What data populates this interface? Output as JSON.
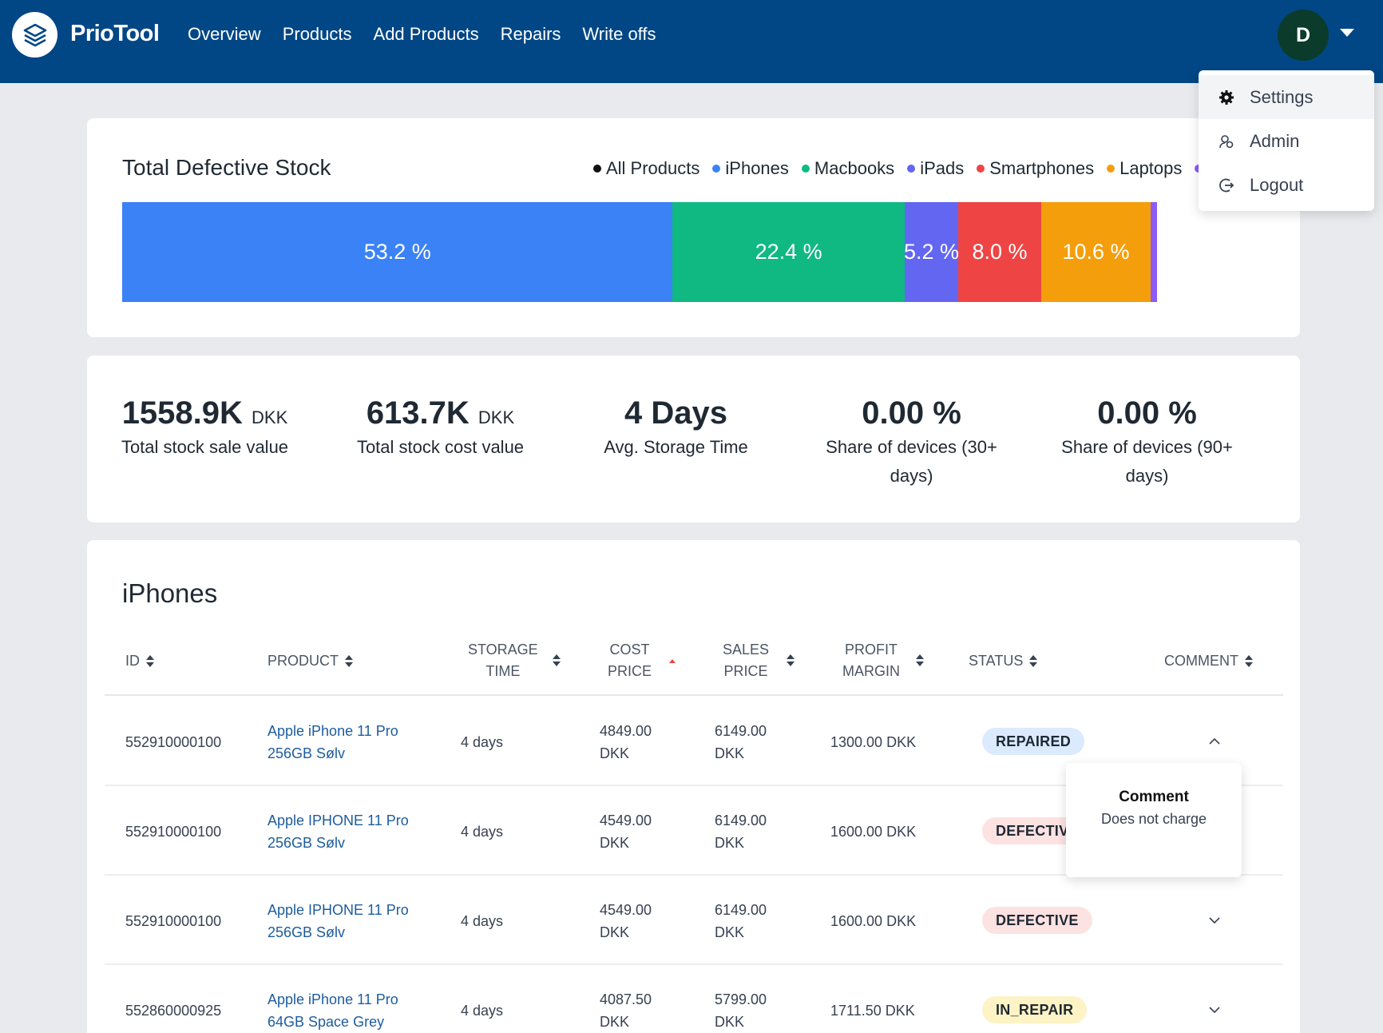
{
  "app": {
    "brand": "PrioTool",
    "nav": [
      "Overview",
      "Products",
      "Add Products",
      "Repairs",
      "Write offs"
    ],
    "avatar_initial": "D"
  },
  "user_menu": {
    "items": [
      {
        "label": "Settings",
        "icon": "gear-icon"
      },
      {
        "label": "Admin",
        "icon": "admin-icon"
      },
      {
        "label": "Logout",
        "icon": "logout-icon"
      }
    ]
  },
  "defective_stock": {
    "title": "Total Defective Stock",
    "legend": [
      {
        "label": "All Products",
        "color": "#111111"
      },
      {
        "label": "iPhones",
        "color": "#3b82f6"
      },
      {
        "label": "Macbooks",
        "color": "#10b981"
      },
      {
        "label": "iPads",
        "color": "#6366f1"
      },
      {
        "label": "Smartphones",
        "color": "#ef4444"
      },
      {
        "label": "Laptops",
        "color": "#f59e0b"
      },
      {
        "label": "",
        "color": "#8b5cf6"
      }
    ]
  },
  "chart_data": {
    "type": "bar",
    "stacked": true,
    "categories": [
      "iPhones",
      "Macbooks",
      "iPads",
      "Smartphones",
      "Laptops",
      ""
    ],
    "values": [
      53.2,
      22.4,
      5.2,
      8.0,
      10.6,
      0.6
    ],
    "labels": [
      "53.2 %",
      "22.4 %",
      "5.2 %",
      "8.0 %",
      "10.6 %",
      ""
    ],
    "colors": [
      "#3b82f6",
      "#10b981",
      "#6366f1",
      "#ef4444",
      "#f59e0b",
      "#8b5cf6"
    ]
  },
  "stats": [
    {
      "value": "1558.9K",
      "unit": "DKK",
      "label": "Total stock sale value"
    },
    {
      "value": "613.7K",
      "unit": "DKK",
      "label": "Total stock cost value"
    },
    {
      "value": "4",
      "unit": "Days",
      "label": "Avg. Storage Time"
    },
    {
      "value": "0.00",
      "unit": "%",
      "label": "Share of devices (30+ days)"
    },
    {
      "value": "0.00",
      "unit": "%",
      "label": "Share of devices (90+ days)"
    }
  ],
  "table": {
    "title": "iPhones",
    "headers": {
      "id": "ID",
      "product": "PRODUCT",
      "storage_1": "STORAGE",
      "storage_2": "TIME",
      "cost_1": "COST",
      "cost_2": "PRICE",
      "sales_1": "SALES",
      "sales_2": "PRICE",
      "profit_1": "PROFIT",
      "profit_2": "MARGIN",
      "status": "STATUS",
      "comment": "COMMENT"
    },
    "rows": [
      {
        "id": "552910000100",
        "product_1": "Apple iPhone 11 Pro",
        "product_2": "256GB Sølv",
        "storage": "4 days",
        "cost_1": "4849.00",
        "cost_2": "DKK",
        "sales_1": "6149.00",
        "sales_2": "DKK",
        "profit": "1300.00 DKK",
        "status": "REPAIRED"
      },
      {
        "id": "552910000100",
        "product_1": "Apple IPHONE 11 Pro",
        "product_2": "256GB Sølv",
        "storage": "4 days",
        "cost_1": "4549.00",
        "cost_2": "DKK",
        "sales_1": "6149.00",
        "sales_2": "DKK",
        "profit": "1600.00 DKK",
        "status": "DEFECTIVE"
      },
      {
        "id": "552910000100",
        "product_1": "Apple IPHONE 11 Pro",
        "product_2": "256GB Sølv",
        "storage": "4 days",
        "cost_1": "4549.00",
        "cost_2": "DKK",
        "sales_1": "6149.00",
        "sales_2": "DKK",
        "profit": "1600.00 DKK",
        "status": "DEFECTIVE"
      },
      {
        "id": "552860000925",
        "product_1": "Apple iPhone 11 Pro",
        "product_2": "64GB Space Grey",
        "storage": "4 days",
        "cost_1": "4087.50",
        "cost_2": "DKK",
        "sales_1": "5799.00",
        "sales_2": "DKK",
        "profit": "1711.50 DKK",
        "status": "IN_REPAIR"
      }
    ],
    "comment_popup": {
      "title": "Comment",
      "body": "Does not charge"
    }
  }
}
